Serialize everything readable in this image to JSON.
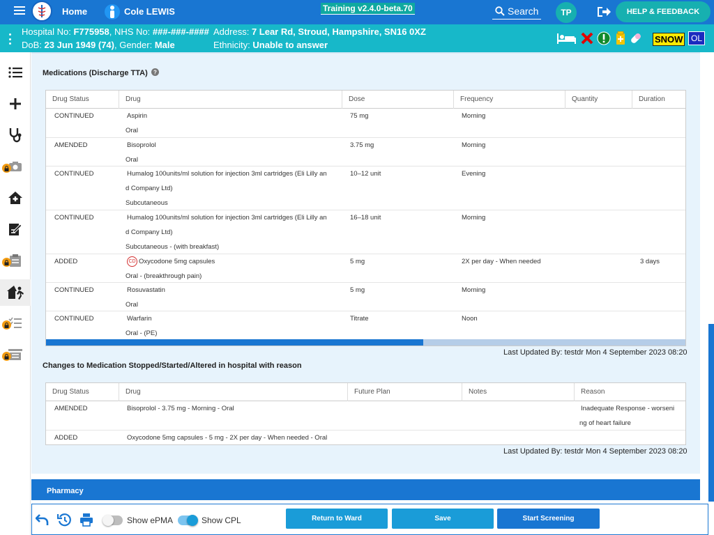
{
  "header": {
    "home_label": "Home",
    "user_name": "Cole LEWIS",
    "version": "Training v2.4.0-beta.70",
    "search_label": "Search",
    "user_initials": "TP",
    "help_label": "HELP & FEEDBACK"
  },
  "patient": {
    "line1_label": "Hospital No:",
    "hospital_no": "F775958",
    "nhs_label": "NHS No:",
    "nhs_no": "###-###-####",
    "address_label": "Address:",
    "address": "7 Lear Rd, Stroud, Hampshire, SN16 0XZ",
    "dob_label": "DoB:",
    "dob": "23 Jun 1949 (74)",
    "gender_label": "Gender:",
    "gender": "Male",
    "ethnicity_label": "Ethnicity:",
    "ethnicity": "Unable to answer",
    "snow_badge": "SNOW",
    "ol_badge": "OL"
  },
  "medications": {
    "title": "Medications (Discharge TTA)",
    "columns": [
      "Drug Status",
      "Drug",
      "Dose",
      "Frequency",
      "Quantity",
      "Duration"
    ],
    "rows": [
      {
        "status": "CONTINUED",
        "drug": "Aspirin",
        "route": "Oral",
        "dose": "75 mg",
        "frequency": "Morning",
        "quantity": "",
        "duration": "",
        "cd": false
      },
      {
        "status": "AMENDED",
        "drug": "Bisoprolol",
        "route": "Oral",
        "dose": "3.75 mg",
        "frequency": "Morning",
        "quantity": "",
        "duration": "",
        "cd": false
      },
      {
        "status": "CONTINUED",
        "drug": "Humalog 100units/ml solution for injection 3ml cartridges (Eli Lilly an",
        "drug2": "d Company Ltd)",
        "route": "Subcutaneous",
        "dose": "10–12 unit",
        "frequency": "Evening",
        "quantity": "",
        "duration": "",
        "cd": false
      },
      {
        "status": "CONTINUED",
        "drug": "Humalog 100units/ml solution for injection 3ml cartridges (Eli Lilly an",
        "drug2": "d Company Ltd)",
        "route": "Subcutaneous - (with breakfast)",
        "dose": "16–18 unit",
        "frequency": "Morning",
        "quantity": "",
        "duration": "",
        "cd": false
      },
      {
        "status": "ADDED",
        "drug": "Oxycodone 5mg capsules",
        "route": "Oral - (breakthrough pain)",
        "dose": "5 mg",
        "frequency": "2X per day - When needed",
        "quantity": "",
        "duration": "3 days",
        "cd": true,
        "cd_label": "CD"
      },
      {
        "status": "CONTINUED",
        "drug": "Rosuvastatin",
        "route": "Oral",
        "dose": "5 mg",
        "frequency": "Morning",
        "quantity": "",
        "duration": "",
        "cd": false
      },
      {
        "status": "CONTINUED",
        "drug": "Warfarin",
        "route": "Oral - (PE)",
        "dose": "Titrate",
        "frequency": "Noon",
        "quantity": "",
        "duration": "",
        "cd": false
      }
    ],
    "scroll_fraction": 0.59,
    "updated": "Last Updated By: testdr Mon 4 September 2023 08:20"
  },
  "changes": {
    "title": "Changes to Medication Stopped/Started/Altered in hospital with reason",
    "columns": [
      "Drug Status",
      "Drug",
      "Future Plan",
      "Notes",
      "Reason"
    ],
    "rows": [
      {
        "status": "AMENDED",
        "drug": "Bisoprolol - 3.75 mg - Morning - Oral",
        "future": "",
        "notes": "",
        "reason": "Inadequate Response - worseni",
        "reason2": "ng of heart failure"
      },
      {
        "status": "ADDED",
        "drug": "Oxycodone 5mg capsules - 5 mg - 2X per day - When needed - Oral",
        "future": "",
        "notes": "",
        "reason": "",
        "reason2": ""
      }
    ],
    "updated": "Last Updated By: testdr Mon 4 September 2023 08:20"
  },
  "pharmacy": {
    "title": "Pharmacy"
  },
  "footer": {
    "epma_label": "Show ePMA",
    "epma_on": false,
    "cpl_label": "Show CPL",
    "cpl_on": true,
    "return_label": "Return to Ward",
    "save_label": "Save",
    "screening_label": "Start Screening"
  },
  "colors": {
    "primary": "#1976d2",
    "teal": "#17b8c9",
    "alert_red": "#d32f2f",
    "lock": "#f39c12"
  },
  "icons": [
    "menu-icon",
    "person-icon",
    "search-icon",
    "logout-icon",
    "bed-icon",
    "red-cross-icon",
    "exclamation-icon",
    "medication-alert-icon",
    "pill-icon",
    "list-icon",
    "plus-icon",
    "stethoscope-icon",
    "camera-icon",
    "home-health-icon",
    "edit-doc-icon",
    "clipboard-icon",
    "discharge-icon",
    "checklist-icon",
    "document-icon",
    "undo-icon",
    "history-icon",
    "print-icon"
  ]
}
